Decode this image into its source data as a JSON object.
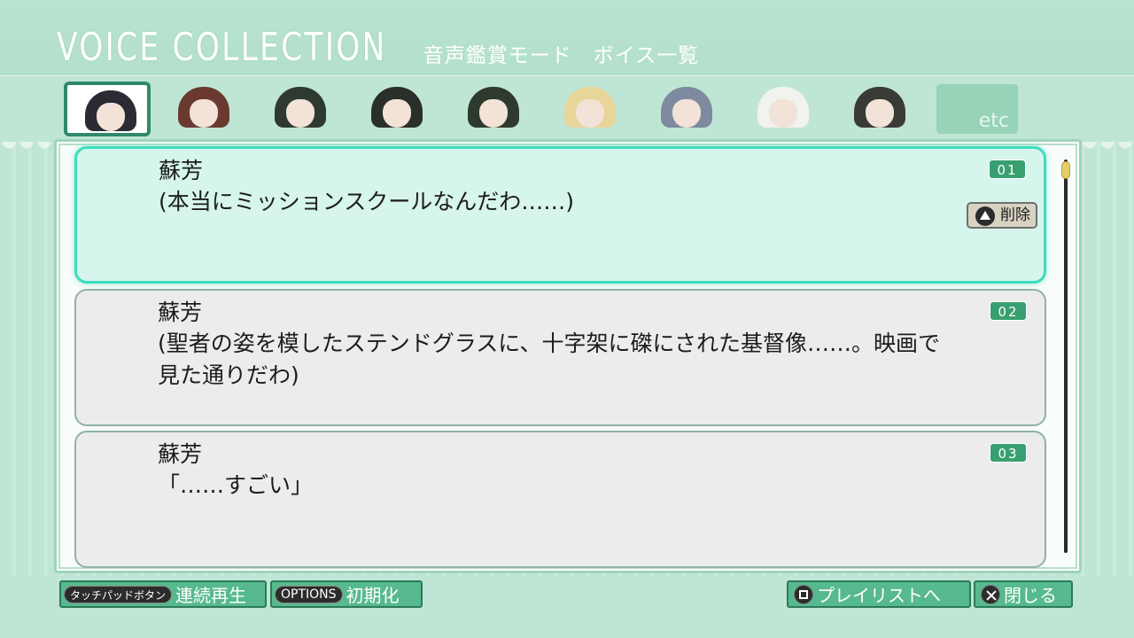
{
  "header": {
    "title": "VOICE COLLECTION",
    "subtitle": "音声鑑賞モード　ボイス一覧"
  },
  "tabs": {
    "selected_index": 0,
    "characters": [
      {
        "hair": "#2b2b33"
      },
      {
        "hair": "#6a3a30"
      },
      {
        "hair": "#2e3a30"
      },
      {
        "hair": "#2a2f2a"
      },
      {
        "hair": "#2f3a2e"
      },
      {
        "hair": "#e7d59a"
      },
      {
        "hair": "#7d8aa0"
      },
      {
        "hair": "#f2f2ee"
      },
      {
        "hair": "#3a3a36"
      }
    ],
    "etc_label": "etc"
  },
  "entries": [
    {
      "number": "01",
      "speaker": "蘇芳",
      "text": "(本当にミッションスクールなんだわ……)",
      "delete_label": "削除"
    },
    {
      "number": "02",
      "speaker": "蘇芳",
      "text": "(聖者の姿を模したステンドグラスに、十字架に磔にされた基督像……。映画で見た通りだわ)"
    },
    {
      "number": "03",
      "speaker": "蘇芳",
      "text": "「……すごい」"
    }
  ],
  "footer": {
    "touchpad_tag": "タッチパッドボタン",
    "touchpad_label": "連続再生",
    "options_tag": "OPTIONS",
    "options_label": "初期化",
    "playlist_label": "プレイリストへ",
    "close_label": "閉じる"
  },
  "colors": {
    "background": "#bfe6d4",
    "accent": "#3ddcc0",
    "button": "#57b98e",
    "number_badge": "#38a070"
  }
}
